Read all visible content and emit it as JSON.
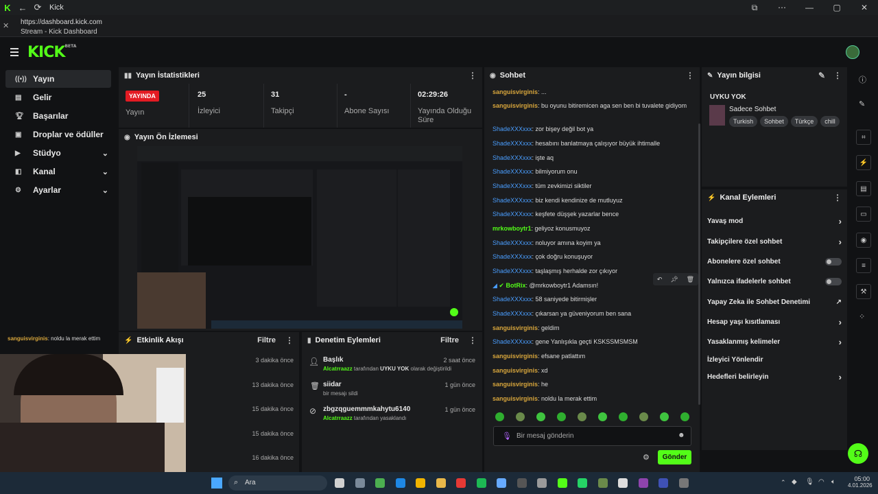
{
  "window": {
    "title": "Kick",
    "url": "https://dashboard.kick.com",
    "tab_title": "Stream - Kick Dashboard"
  },
  "header": {
    "logo": "KICK",
    "logo_badge": "BETA"
  },
  "sidebar": {
    "items": [
      {
        "label": "Yayın",
        "icon": "broadcast-icon",
        "active": true
      },
      {
        "label": "Gelir",
        "icon": "revenue-icon"
      },
      {
        "label": "Başarılar",
        "icon": "trophy-icon"
      },
      {
        "label": "Droplar ve ödüller",
        "icon": "gift-icon"
      },
      {
        "label": "Stüdyo",
        "icon": "studio-icon",
        "expandable": true
      },
      {
        "label": "Kanal",
        "icon": "channel-icon",
        "expandable": true
      },
      {
        "label": "Ayarlar",
        "icon": "gear-icon",
        "expandable": true
      }
    ]
  },
  "stats": {
    "title": "Yayın İstatistikleri",
    "live_badge": "YAYINDA",
    "live_label": "Yayın",
    "viewers": {
      "value": "25",
      "label": "İzleyici"
    },
    "followers": {
      "value": "31",
      "label": "Takipçi"
    },
    "subs": {
      "value": "-",
      "label": "Abone Sayısı"
    },
    "uptime": {
      "value": "02:29:26",
      "label": "Yayında Olduğu Süre"
    }
  },
  "preview": {
    "title": "Yayın Ön İzlemesi"
  },
  "overlay_chat": {
    "user": "sanguisvirginis",
    "text": "noldu la merak ettim"
  },
  "activity": {
    "title": "Etkinlik Akışı",
    "filter": "Filtre",
    "times": [
      "3 dakika önce",
      "13 dakika önce",
      "15 dakika önce",
      "15 dakika önce",
      "16 dakika önce"
    ]
  },
  "moderation": {
    "title": "Denetim Eylemleri",
    "filter": "Filtre",
    "items": [
      {
        "title": "Başlık",
        "user": "Alcatrraazz",
        "detail_pre": " tarafından ",
        "detail_bold": "UYKU YOK",
        "detail_post": " olarak değiştirildi",
        "time": "2 saat önce"
      },
      {
        "title": "siidar",
        "detail": "bir mesajı sildi",
        "time": "1 gün önce"
      },
      {
        "title": "zbgzqguemmmkahytu6140",
        "user": "Alcatrraazz",
        "detail_post": " tarafından yasaklandı",
        "time": "1 gün önce"
      }
    ]
  },
  "chat": {
    "title": "Sohbet",
    "messages": [
      {
        "user": "sanguisvirginis",
        "color": "or",
        "text": ": ..."
      },
      {
        "user": "sanguisvirginis",
        "color": "or",
        "text": ": bu oyunu bitiremicen aga sen ben bi tuvalete gidiyom"
      },
      {
        "user": "ShadeXXXxxx",
        "color": "bl",
        "text": ": zor bişey değil bot ya"
      },
      {
        "user": "ShadeXXXxxx",
        "color": "bl",
        "text": ": hesabını banlatmaya çalışıyor büyük ihtimalle"
      },
      {
        "user": "ShadeXXXxxx",
        "color": "bl",
        "text": ": işte aq"
      },
      {
        "user": "ShadeXXXxxx",
        "color": "bl",
        "text": ": bilmiyorum onu"
      },
      {
        "user": "ShadeXXXxxx",
        "color": "bl",
        "text": ": tüm zevkimizi siktiler"
      },
      {
        "user": "ShadeXXXxxx",
        "color": "bl",
        "text": ": biz kendi kendinize de mutluyuz"
      },
      {
        "user": "ShadeXXXxxx",
        "color": "bl",
        "text": ": keşfete düşşek yazarlar bence"
      },
      {
        "user": "mrkowboytr1",
        "color": "gr",
        "text": ": geliyoz konusmuyoz"
      },
      {
        "user": "ShadeXXXxxx",
        "color": "bl",
        "text": ": noluyor amına koyim ya"
      },
      {
        "user": "ShadeXXXxxx",
        "color": "bl",
        "text": ": çok doğru konuşuyor"
      },
      {
        "user": "ShadeXXXxxx",
        "color": "bl",
        "text": ": taşlaşmış herhalde zor çıkıyor"
      },
      {
        "user": "BotRix",
        "color": "gr",
        "text": ": @mrkowboytr1 Adamsın!"
      },
      {
        "user": "ShadeXXXxxx",
        "color": "bl",
        "text": ": 58 saniyede bitirmişler"
      },
      {
        "user": "ShadeXXXxxx",
        "color": "bl",
        "text": ": çıkarsan ya güveniyorum ben sana"
      },
      {
        "user": "sanguisvirginis",
        "color": "or",
        "text": ": geldim"
      },
      {
        "user": "ShadeXXXxxx",
        "color": "bl",
        "text": ": gene Yanlışıkla geçti KSKSSMSMSM"
      },
      {
        "user": "sanguisvirginis",
        "color": "or",
        "text": ": efsane patlattım"
      },
      {
        "user": "sanguisvirginis",
        "color": "or",
        "text": ": xd"
      },
      {
        "user": "sanguisvirginis",
        "color": "or",
        "text": ": he"
      },
      {
        "user": "sanguisvirginis",
        "color": "or",
        "text": ": noldu la merak ettim"
      }
    ],
    "input_placeholder": "Bir mesaj gönderin",
    "send": "Gönder"
  },
  "stream_info": {
    "title": "Yayın bilgisi",
    "stream_title": "UYKU YOK",
    "category": "Sadece Sohbet",
    "tags": [
      "Turkish",
      "Sohbet",
      "Türkçe",
      "chill"
    ]
  },
  "channel_actions": {
    "title": "Kanal Eylemleri",
    "items": [
      {
        "label": "Yavaş mod",
        "type": "chevron"
      },
      {
        "label": "Takipçilere özel sohbet",
        "type": "chevron"
      },
      {
        "label": "Abonelere özel sohbet",
        "type": "toggle"
      },
      {
        "label": "Yalnızca ifadelerle sohbet",
        "type": "toggle"
      },
      {
        "label": "Yapay Zeka ile Sohbet Denetimi",
        "type": "external"
      },
      {
        "label": "Hesap yaşı kısıtlaması",
        "type": "chevron"
      },
      {
        "label": "Yasaklanmış kelimeler",
        "type": "chevron"
      },
      {
        "label": "İzleyici Yönlendir",
        "type": "none"
      },
      {
        "label": "Hedefleri belirleyin",
        "type": "chevron"
      }
    ]
  },
  "taskbar": {
    "search": "Ara",
    "time": "05:00",
    "date": "4.01.2026"
  },
  "colors": {
    "accent": "#53fc18",
    "live": "#e31b23",
    "user_orange": "#d8a63c",
    "user_blue": "#4a9eff"
  }
}
